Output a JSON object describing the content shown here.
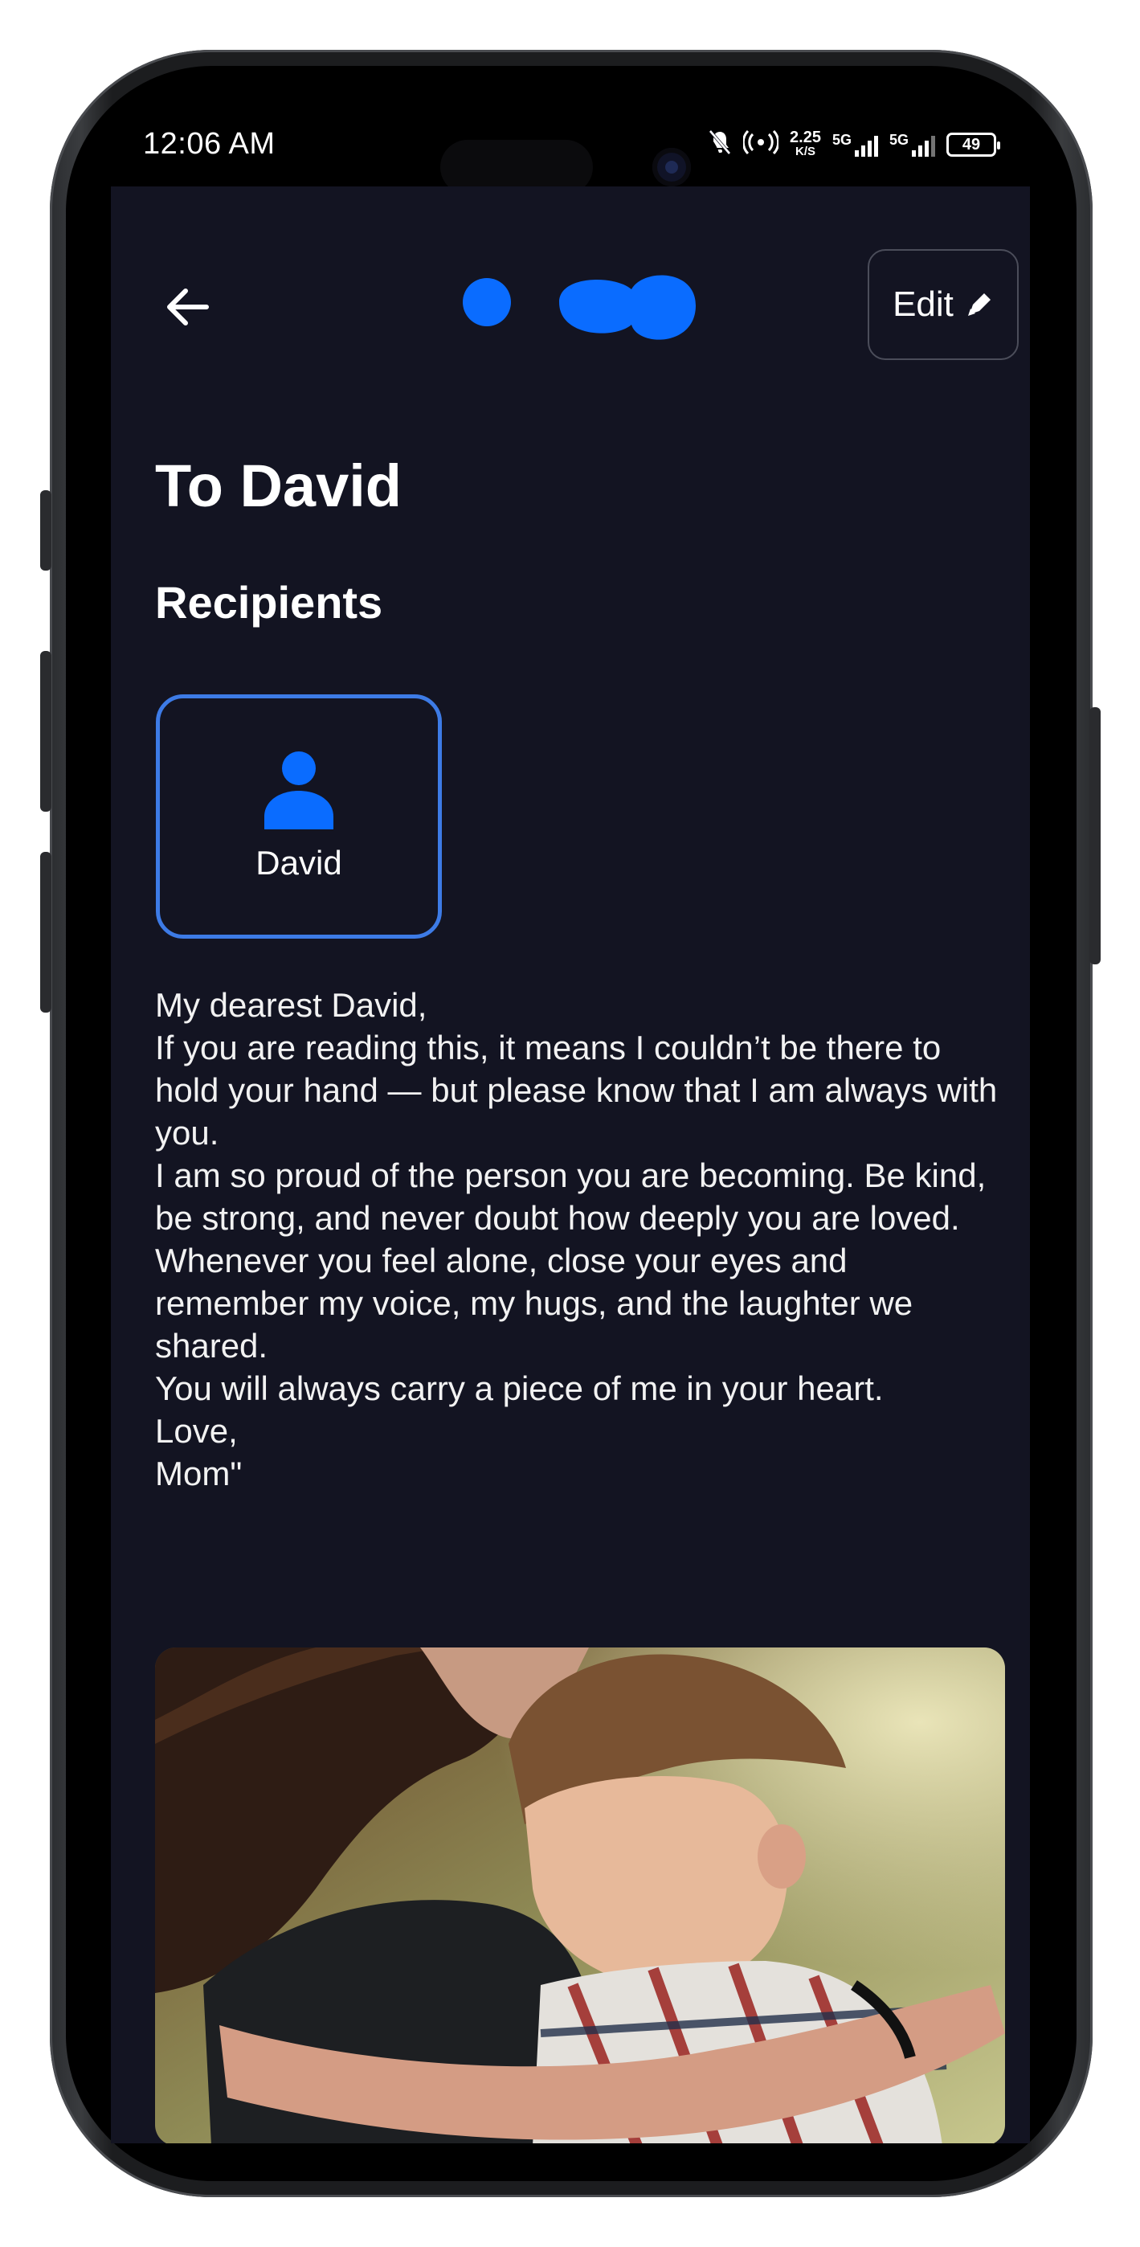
{
  "status_bar": {
    "time": "12:06 AM",
    "net_speed_value": "2.25",
    "net_speed_unit": "K/S",
    "signal1_label": "5G",
    "signal2_label": "5G",
    "battery": "49"
  },
  "header": {
    "edit_label": "Edit",
    "logo_color": "#0a6cff"
  },
  "page": {
    "title": "To David",
    "recipients_heading": "Recipients"
  },
  "recipients": [
    {
      "name": "David"
    }
  ],
  "message": {
    "lines": [
      "My dearest David,",
      "If you are reading this, it means I couldn’t be there to hold your hand — but please know that I am always with you.",
      "I am so proud of the person you are becoming. Be kind, be strong, and never doubt how deeply you are loved.",
      "Whenever you feel alone, close your eyes and remember my voice, my hugs, and the laughter we shared.",
      "You will always carry a piece of me in your heart.",
      "Love,",
      "Mom\""
    ]
  },
  "colors": {
    "background": "#131422",
    "accent": "#0a6cff",
    "card_border": "#3d7be6"
  },
  "icons": {
    "back": "arrow-left-icon",
    "edit": "pencil-icon",
    "recipient": "person-icon"
  }
}
